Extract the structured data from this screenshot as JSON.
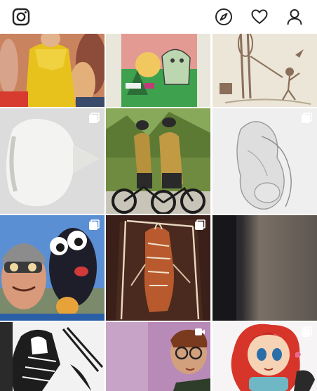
{
  "app": {
    "name": "Instagram"
  },
  "header": {
    "icons": [
      "instagram-logo-icon",
      "compass-icon",
      "heart-icon",
      "profile-icon"
    ]
  },
  "feed": {
    "posts": [
      {
        "subject": "woman-in-yellow-dress",
        "type": "photo"
      },
      {
        "subject": "cartoon-creature-illustration",
        "type": "photo"
      },
      {
        "subject": "skeleton-and-child-sketch",
        "type": "photo"
      },
      {
        "subject": "white-bird-sculpture",
        "type": "carousel"
      },
      {
        "subject": "cyclists-in-gold-kits",
        "type": "photo"
      },
      {
        "subject": "embracing-figures-sketch",
        "type": "carousel"
      },
      {
        "subject": "masked-selfie-with-puppet",
        "type": "carousel"
      },
      {
        "subject": "figure-in-frame-painting",
        "type": "carousel"
      },
      {
        "subject": "dark-abstract-wall",
        "type": "photo"
      },
      {
        "subject": "armored-knight-comic",
        "type": "photo"
      },
      {
        "subject": "man-with-glasses-on-purple",
        "type": "video"
      },
      {
        "subject": "red-haired-anime-girl",
        "type": "carousel"
      }
    ]
  },
  "colors": {
    "background": "#ffffff",
    "icon": "#262626",
    "badge": "#ffffff"
  }
}
